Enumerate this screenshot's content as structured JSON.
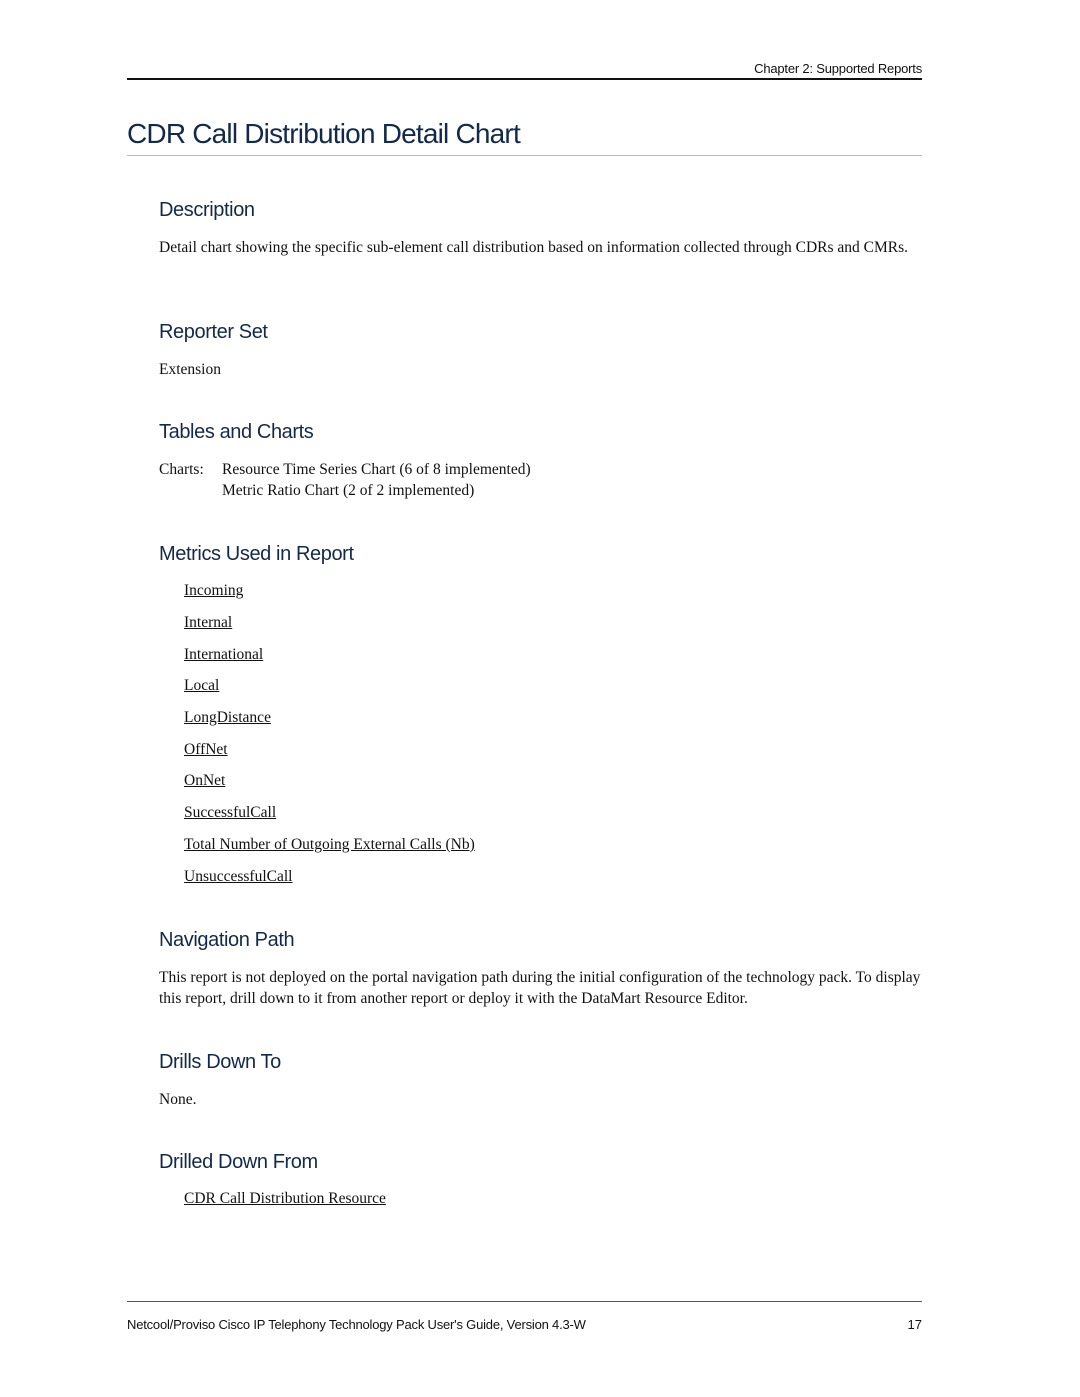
{
  "header": {
    "chapter": "Chapter 2: Supported Reports"
  },
  "title": "CDR Call Distribution Detail Chart",
  "sections": {
    "description": {
      "heading": "Description",
      "text": "Detail chart showing the specific sub-element call distribution based on information collected through CDRs and CMRs."
    },
    "reporter_set": {
      "heading": "Reporter Set",
      "text": "Extension"
    },
    "tables_and_charts": {
      "heading": "Tables and Charts",
      "label": "Charts:",
      "items": [
        "Resource Time Series Chart (6 of 8 implemented)",
        "Metric Ratio Chart (2 of 2 implemented)"
      ]
    },
    "metrics": {
      "heading": "Metrics Used in Report",
      "links": [
        "Incoming",
        "Internal",
        "International",
        "Local",
        "LongDistance",
        "OffNet",
        "OnNet",
        "SuccessfulCall",
        "Total Number of Outgoing External Calls (Nb)",
        "UnsuccessfulCall"
      ]
    },
    "navigation_path": {
      "heading": "Navigation Path",
      "text": "This report is not deployed on the portal navigation path during the initial configuration of the technology pack. To display this report, drill down to it from another report or deploy it with the DataMart Resource Editor."
    },
    "drills_down_to": {
      "heading": "Drills Down To",
      "text": "None."
    },
    "drilled_down_from": {
      "heading": "Drilled Down From",
      "links": [
        "CDR Call Distribution Resource"
      ]
    }
  },
  "footer": {
    "text": "Netcool/Proviso Cisco IP Telephony Technology Pack User's Guide, Version 4.3-W",
    "page_number": "17"
  }
}
